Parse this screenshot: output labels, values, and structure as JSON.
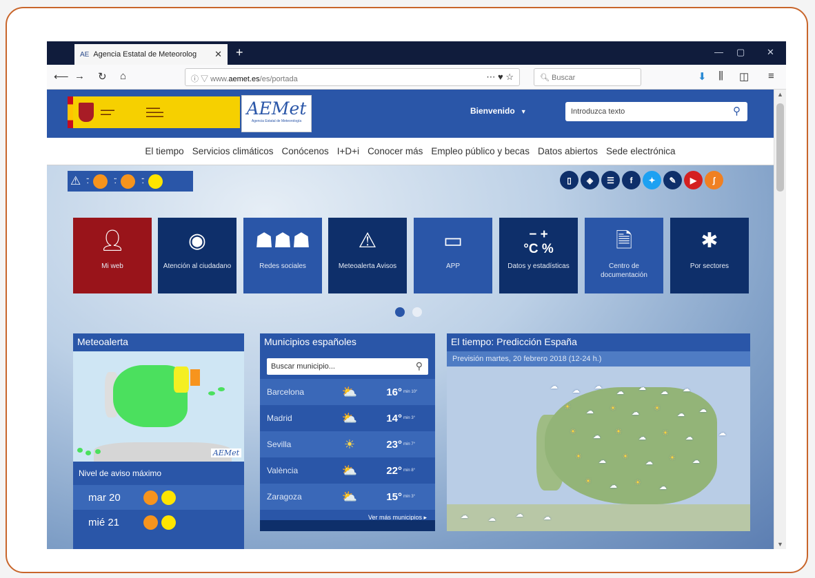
{
  "browser": {
    "tab_title": "Agencia Estatal de Meteorolog",
    "tab_favicon": "AE",
    "url_prefix": "www.",
    "url_domain": "aemet.es",
    "url_path": "/es/portada",
    "search_placeholder": "Buscar"
  },
  "header": {
    "logo_text": "AEMet",
    "logo_subtext": "Agencia Estatal de Meteorología",
    "welcome": "Bienvenido",
    "search_placeholder": "Introduzca texto"
  },
  "menu": [
    "El tiempo",
    "Servicios climáticos",
    "Conócenos",
    "I+D+i",
    "Conocer más",
    "Empleo público y becas",
    "Datos abiertos",
    "Sede electrónica"
  ],
  "tiles": [
    {
      "label": "Mi web",
      "icon": "user-icon"
    },
    {
      "label": "Atención al ciudadano",
      "icon": "support-icon"
    },
    {
      "label": "Redes sociales",
      "icon": "people-icon"
    },
    {
      "label": "Meteoalerta Avisos",
      "icon": "warning-icon"
    },
    {
      "label": "APP",
      "icon": "tablet-icon"
    },
    {
      "label": "Datos y estadísticas",
      "icon": "stats-icon"
    },
    {
      "label": "Centro de documentación",
      "icon": "document-icon"
    },
    {
      "label": "Por sectores",
      "icon": "sectors-icon"
    }
  ],
  "tile_stats_symbols": {
    "minus_plus": "− +",
    "celsius_percent": "°C %"
  },
  "meteoalerta": {
    "title": "Meteoalerta",
    "nivel_title": "Nivel de aviso máximo",
    "days": [
      {
        "day": "mar 20",
        "colors": [
          "#f7941d",
          "#ffe500"
        ]
      },
      {
        "day": "mié 21",
        "colors": [
          "#f7941d",
          "#ffe500"
        ]
      }
    ],
    "map_logo": "AEMet"
  },
  "municipios": {
    "title": "Municipios españoles",
    "search_placeholder": "Buscar municipio...",
    "rows": [
      {
        "city": "Barcelona",
        "max": "16°",
        "min": "min 10°",
        "icon": "partly-cloudy-icon"
      },
      {
        "city": "Madrid",
        "max": "14°",
        "min": "min 3°",
        "icon": "partly-cloudy-icon"
      },
      {
        "city": "Sevilla",
        "max": "23°",
        "min": "min 7°",
        "icon": "sun-icon"
      },
      {
        "city": "València",
        "max": "22°",
        "min": "min 8°",
        "icon": "partly-cloudy-icon"
      },
      {
        "city": "Zaragoza",
        "max": "15°",
        "min": "min 3°",
        "icon": "partly-cloudy-icon"
      }
    ],
    "more": "Ver más municipios ▸"
  },
  "prediccion": {
    "title": "El tiempo: Predicción España",
    "subtitle": "Previsión martes, 20 febrero 2018 (12-24 h.)"
  },
  "colors": {
    "primary": "#2a56a8",
    "dark": "#0e2f6a",
    "red": "#99141a",
    "orange": "#f7941d",
    "yellow": "#ffe500",
    "frame": "#c8652a"
  }
}
